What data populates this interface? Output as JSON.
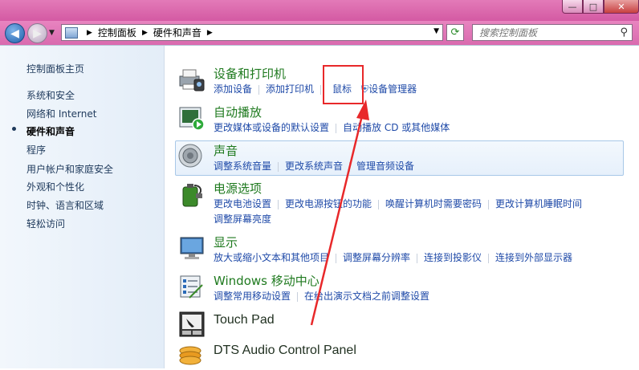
{
  "window": {
    "min": "—",
    "max": "□",
    "close": "✕"
  },
  "nav": {
    "breadcrumb": [
      "控制面板",
      "硬件和声音"
    ],
    "search_placeholder": "搜索控制面板"
  },
  "sidebar": {
    "items": [
      {
        "label": "控制面板主页"
      },
      {
        "label": "系统和安全"
      },
      {
        "label": "网络和 Internet"
      },
      {
        "label": "硬件和声音",
        "active": true
      },
      {
        "label": "程序"
      },
      {
        "label": "用户帐户和家庭安全"
      },
      {
        "label": "外观和个性化"
      },
      {
        "label": "时钟、语言和区域"
      },
      {
        "label": "轻松访问"
      }
    ]
  },
  "categories": [
    {
      "title": "设备和打印机",
      "links": [
        "添加设备",
        "添加打印机",
        "鼠标",
        "设备管理器"
      ]
    },
    {
      "title": "自动播放",
      "links": [
        "更改媒体或设备的默认设置",
        "自动播放 CD 或其他媒体"
      ]
    },
    {
      "title": "声音",
      "links": [
        "调整系统音量",
        "更改系统声音",
        "管理音频设备"
      ]
    },
    {
      "title": "电源选项",
      "links": [
        "更改电池设置",
        "更改电源按钮的功能",
        "唤醒计算机时需要密码",
        "更改计算机睡眠时间"
      ],
      "links2": [
        "调整屏幕亮度"
      ]
    },
    {
      "title": "显示",
      "links": [
        "放大或缩小文本和其他项目",
        "调整屏幕分辨率",
        "连接到投影仪",
        "连接到外部显示器"
      ]
    },
    {
      "title": "Windows 移动中心",
      "links": [
        "调整常用移动设置",
        "在给出演示文档之前调整设置"
      ]
    },
    {
      "title": "Touch Pad",
      "links": []
    },
    {
      "title": "DTS Audio Control Panel",
      "links": []
    }
  ],
  "colors": {
    "titlebar": "#d96aae",
    "link": "#1f4aa8",
    "title_green": "#1f6b10",
    "annotation_red": "#e8282a"
  }
}
